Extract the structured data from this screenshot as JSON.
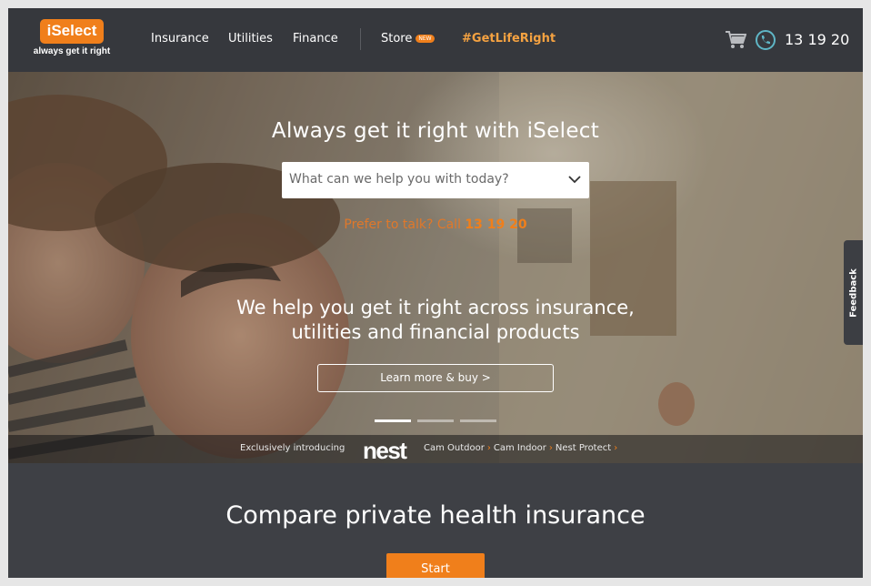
{
  "brand": {
    "logo_text": "iSelect",
    "tagline": "always get it right",
    "accent_color": "#f07f1b"
  },
  "nav": {
    "items": [
      {
        "label": "Insurance"
      },
      {
        "label": "Utilities"
      },
      {
        "label": "Finance"
      }
    ],
    "store": {
      "label": "Store",
      "badge": "NEW"
    },
    "hashtag": "#GetLifeRight",
    "cart_icon": "shopping-cart-icon",
    "phone_icon": "phone-icon",
    "phone": "13 19 20"
  },
  "hero": {
    "title": "Always get it right with iSelect",
    "select_placeholder": "What can we help you with today?",
    "talk_text": "Prefer to talk? Call",
    "talk_number": "13 19 20",
    "headline_line1": "We help you get it right across insurance,",
    "headline_line2": "utilities and financial products",
    "cta_label": "Learn more & buy >",
    "carousel_active_index": 0,
    "carousel_count": 3
  },
  "nest_bar": {
    "intro": "Exclusively introducing",
    "logo": "nest",
    "links": [
      "Cam Outdoor",
      "Cam Indoor",
      "Nest Protect"
    ],
    "separator": "›"
  },
  "feedback": {
    "label": "Feedback"
  },
  "compare": {
    "title": "Compare private health insurance",
    "start_label": "Start"
  }
}
